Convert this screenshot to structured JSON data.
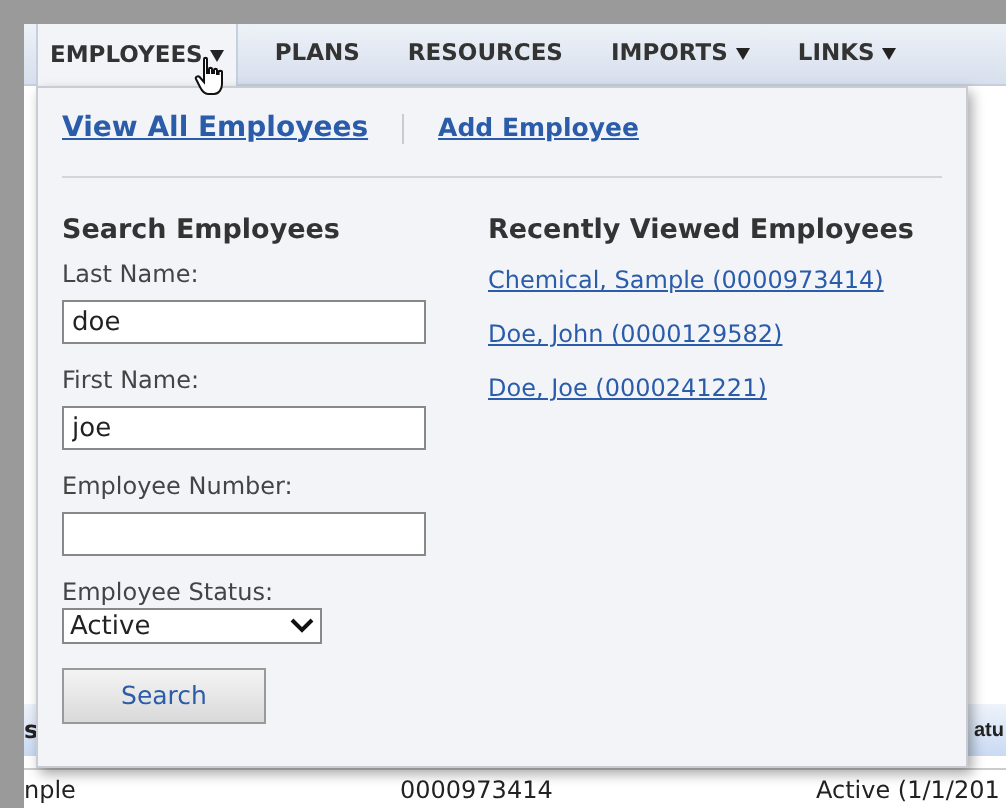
{
  "nav": {
    "items": [
      {
        "label": "EMPLOYEES",
        "caret": true,
        "selected": true
      },
      {
        "label": "PLANS",
        "caret": false,
        "selected": false
      },
      {
        "label": "RESOURCES",
        "caret": false,
        "selected": false
      },
      {
        "label": "IMPORTS",
        "caret": true,
        "selected": false
      },
      {
        "label": "LINKS",
        "caret": true,
        "selected": false
      }
    ]
  },
  "menu": {
    "links": [
      "View All Employees",
      "Add Employee"
    ],
    "search": {
      "title": "Search Employees",
      "fields": [
        {
          "kind": "text",
          "label": "Last Name:",
          "value": "doe"
        },
        {
          "kind": "text",
          "label": "First Name:",
          "value": "joe"
        },
        {
          "kind": "text",
          "label": "Employee Number:"
        },
        {
          "kind": "select",
          "label": "Employee Status:",
          "value": "Active"
        }
      ],
      "button": "Search"
    },
    "recent": {
      "title": "Recently Viewed Employees",
      "items": [
        "Chemical, Sample (0000973414)",
        "Doe, John (0000129582)",
        "Doe, Joe (0000241221)"
      ]
    }
  },
  "background": {
    "header": [
      "s",
      "atu"
    ],
    "row": [
      "nple",
      "0000973414",
      "Active (1/1/201"
    ]
  }
}
